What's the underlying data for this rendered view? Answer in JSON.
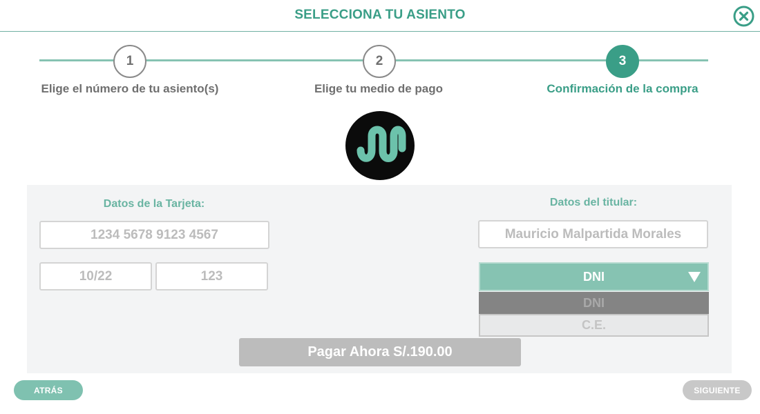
{
  "header": {
    "title": "SELECCIONA TU ASIENTO"
  },
  "steps": [
    {
      "number": "1",
      "label": "Elige el número de tu asiento(s)"
    },
    {
      "number": "2",
      "label": "Elige tu medio de pago"
    },
    {
      "number": "3",
      "label": "Confirmación de la compra"
    }
  ],
  "card": {
    "title": "Datos de la Tarjeta:",
    "number_placeholder": "1234 5678 9123 4567",
    "expiry_placeholder": "10/22",
    "cvv_placeholder": "123"
  },
  "holder": {
    "title": "Datos del titular:",
    "name_placeholder": "Mauricio Malpartida Morales",
    "doc_type_selected": "DNI",
    "doc_type_options": [
      "DNI",
      "C.E."
    ]
  },
  "pay_button": "Pagar Ahora S/.190.00",
  "nav": {
    "back": "ATRÁS",
    "next": "SIGUIENTE"
  },
  "colors": {
    "accent": "#3a9e87",
    "accent_light": "#86c3b2",
    "disabled": "#bcbcbc"
  },
  "icons": {
    "close": "close-circle-icon",
    "logo": "brand-logo-icon",
    "dropdown": "caret-down-icon"
  }
}
